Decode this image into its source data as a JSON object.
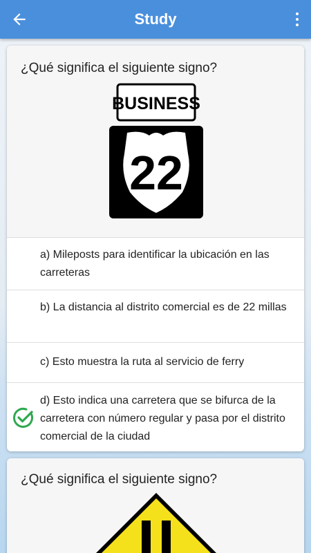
{
  "appbar": {
    "title": "Study",
    "back_icon": "arrow-left-icon",
    "menu_icon": "more-vertical-icon",
    "color": "#4a8fdc"
  },
  "question1": {
    "text": "¿Qué significa el siguiente signo?",
    "sign": {
      "top_label": "BUSINESS",
      "route_number": "22"
    },
    "answers": [
      {
        "label": "a) Mileposts para identificar la ubicación en las carreteras",
        "correct": false
      },
      {
        "label": "b) La distancia al distrito comercial es de 22 millas",
        "correct": false
      },
      {
        "label": "c) Esto muestra la ruta al servicio de ferry",
        "correct": false
      },
      {
        "label": "d) Esto indica una carretera que se bifurca de la carretera con número regular y pasa por el distrito comercial de la ciudad",
        "correct": true
      }
    ],
    "correct_color": "#2fa84f"
  },
  "question2": {
    "text": "¿Qué significa el siguiente signo?",
    "sign_color": "#f5e11b"
  }
}
